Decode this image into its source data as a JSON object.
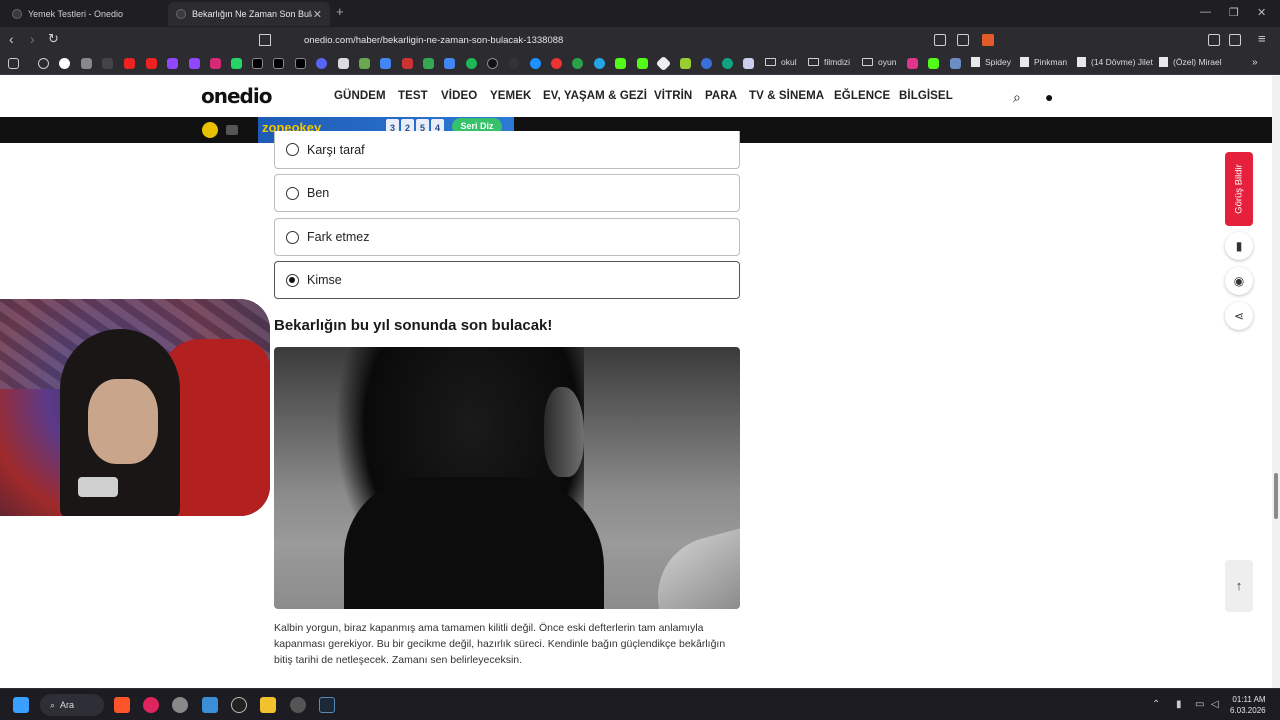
{
  "browser": {
    "tabs": [
      {
        "title": "Yemek Testleri - Onedio",
        "active": false
      },
      {
        "title": "Bekarlığın Ne Zaman Son Bulaca",
        "active": true
      }
    ],
    "url": "onedio.com/haber/bekarligin-ne-zaman-son-bulacak-1338088",
    "bookmarks": [
      "okul",
      "filmdizi",
      "oyun",
      "Spidey",
      "Pinkman",
      "(14 Dövme) Jilet",
      "(Özel) Mirael"
    ]
  },
  "site": {
    "logo": "onedio",
    "nav": [
      "GÜNDEM",
      "TEST",
      "VİDEO",
      "YEMEK",
      "EV, YAŞAM & GEZİ",
      "VİTRİN",
      "PARA",
      "TV & SİNEMA",
      "EĞLENCE",
      "BİLGİSEL"
    ]
  },
  "ad": {
    "brand": "zoneokey",
    "tiles": [
      "3",
      "2",
      "5",
      "4"
    ],
    "cta": "Seri Diz"
  },
  "quiz": {
    "options": [
      {
        "label": "Karşı taraf",
        "selected": false
      },
      {
        "label": "Ben",
        "selected": false
      },
      {
        "label": "Fark etmez",
        "selected": false
      },
      {
        "label": "Kimse",
        "selected": true
      }
    ]
  },
  "result": {
    "title": "Bekarlığın bu yıl sonunda son bulacak!",
    "text": "Kalbin yorgun, biraz kapanmış ama tamamen kilitli değil. Önce eski defterlerin tam anlamıyla kapanması gerekiyor. Bu bir gecikme değil, hazırlık süreci. Kendinle bağın güçlendikçe bekârlığın bitiş tarihi de netleşecek. Zamanı sen belirleyeceksin."
  },
  "sidebar": {
    "feedback": "Görüş Bildir"
  },
  "taskbar": {
    "search": "Ara",
    "time": "01:11 AM",
    "date": "6.03.2026"
  },
  "colors": {
    "accent": "#e5203c",
    "chrome_bg": "#2b2b30",
    "taskbar_bg": "#1c1c22"
  }
}
